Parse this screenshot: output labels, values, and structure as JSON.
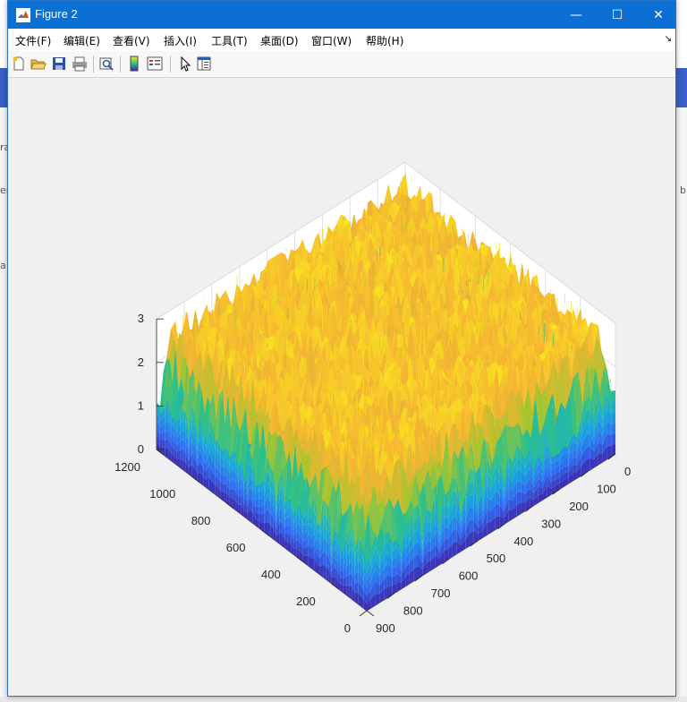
{
  "window": {
    "title": "Figure 2",
    "minimize_glyph": "—",
    "maximize_glyph": "☐",
    "close_glyph": "✕"
  },
  "menu": {
    "items": [
      "文件(F)",
      "编辑(E)",
      "查看(V)",
      "插入(I)",
      "工具(T)",
      "桌面(D)",
      "窗口(W)",
      "帮助(H)"
    ]
  },
  "toolbar": {
    "icons": [
      "new-figure-icon",
      "open-icon",
      "save-icon",
      "print-icon",
      "print-preview-icon",
      "colorbar-icon",
      "legend-icon",
      "pointer-icon",
      "property-inspector-icon"
    ]
  },
  "background_fragments": {
    "left_glyphs": [
      "ra",
      "er",
      "a"
    ],
    "right_glyphs": [
      "b"
    ]
  },
  "chart_data": {
    "type": "surface3d",
    "title": "",
    "xlabel": "",
    "ylabel": "",
    "zlabel": "",
    "x_ticks": [
      0,
      200,
      400,
      600,
      800,
      1000,
      1200
    ],
    "y_ticks": [
      0,
      100,
      200,
      300,
      400,
      500,
      600,
      700,
      800,
      900
    ],
    "z_ticks": [
      0,
      1,
      2,
      3
    ],
    "xlim": [
      0,
      1200
    ],
    "ylim": [
      0,
      900
    ],
    "zlim": [
      0,
      3
    ],
    "grid": true,
    "colormap": "parula",
    "colors": [
      "#3e26a8",
      "#2f6cf3",
      "#16a8d8",
      "#2ec08a",
      "#a6c52f",
      "#f5b334",
      "#f9e91c"
    ],
    "description_values": {
      "base_level": 1.3,
      "plateau_level": 2.6,
      "noise_amplitude": 0.5
    }
  }
}
